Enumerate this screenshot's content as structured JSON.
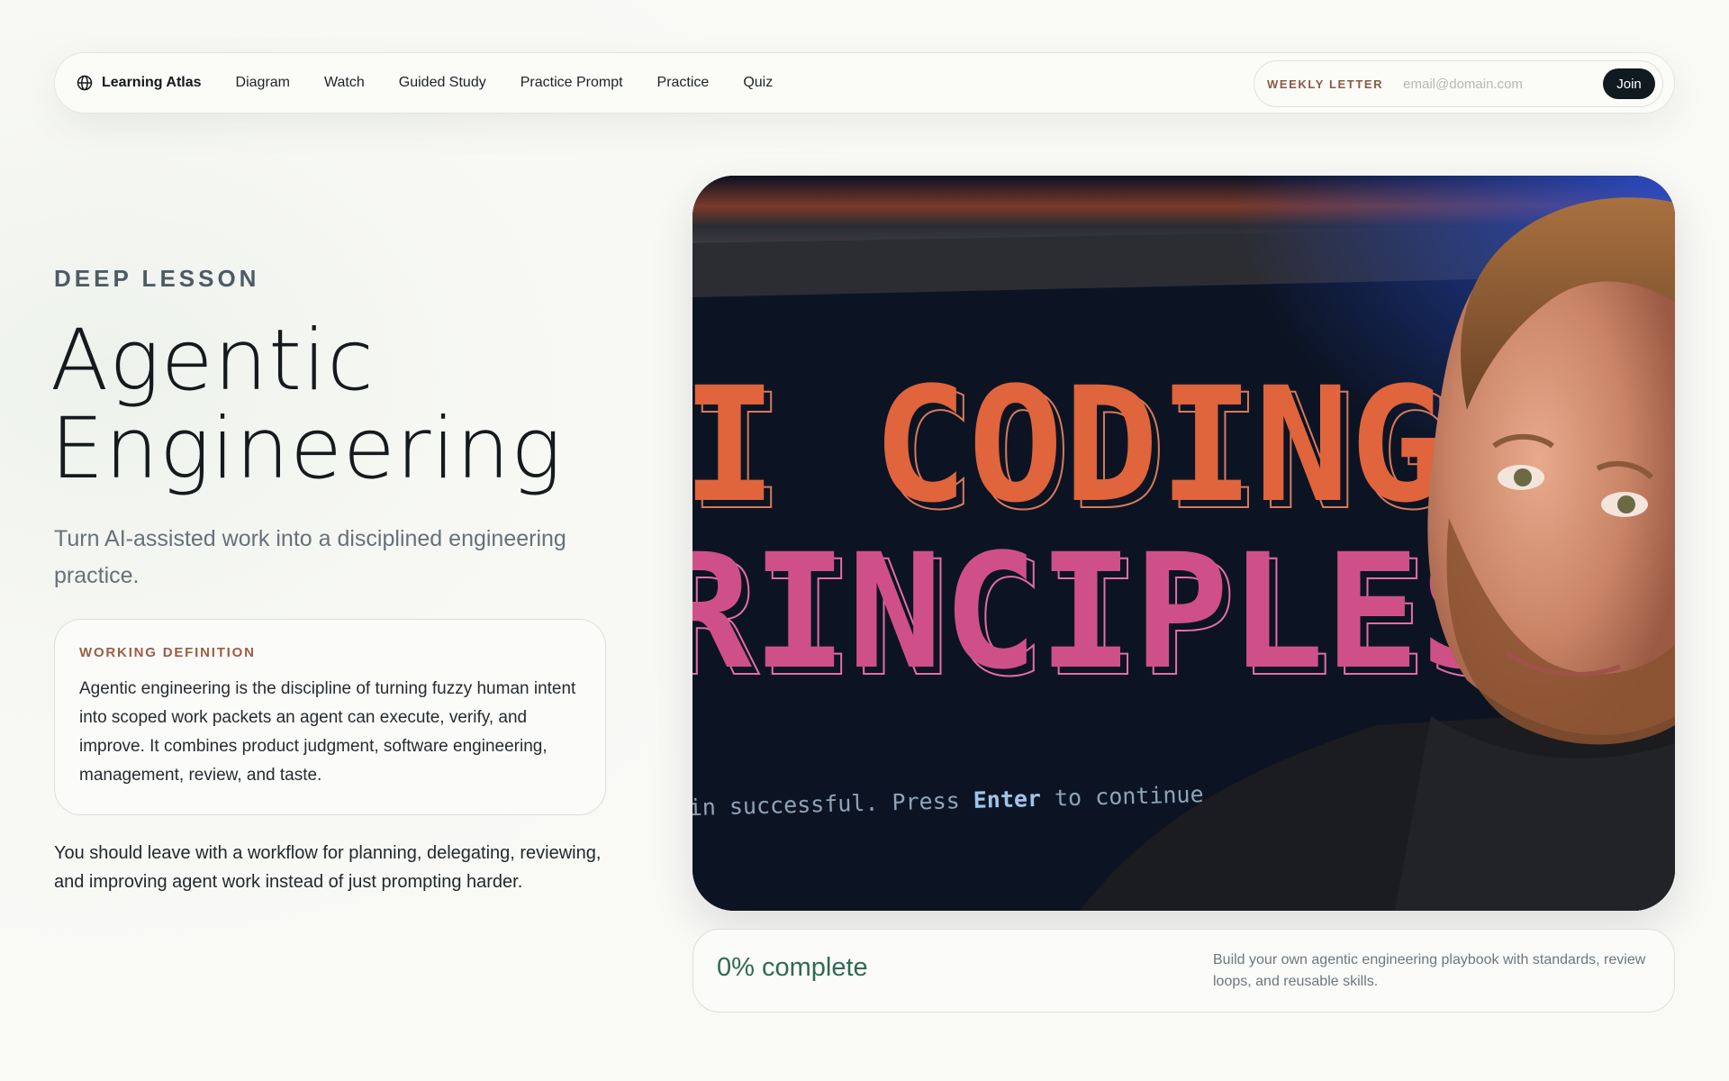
{
  "nav": {
    "brand": "Learning Atlas",
    "brand_icon": "globe-icon",
    "links": [
      "Diagram",
      "Watch",
      "Guided Study",
      "Practice Prompt",
      "Practice",
      "Quiz"
    ],
    "newsletter": {
      "label": "WEEKLY LETTER",
      "placeholder": "email@domain.com",
      "button": "Join"
    }
  },
  "hero": {
    "eyebrow": "DEEP LESSON",
    "title_line1": "Agentic",
    "title_line2": "Engineering",
    "subtitle": "Turn AI-assisted work into a disciplined engineering practice.",
    "definition": {
      "label": "WORKING DEFINITION",
      "text": "Agentic engineering is the discipline of turning fuzzy human intent into scoped work packets an agent can execute, verify, and improve. It combines product judgment, software engineering, management, review, and taste."
    },
    "outcome": "You should leave with a workflow for planning, delegating, reviewing, and improving agent work instead of just prompting harder."
  },
  "video": {
    "thumb_line1": "I CODING",
    "thumb_line2": "RINCIPLES",
    "terminal_prefix": "in successful. Press ",
    "terminal_key": "Enter",
    "terminal_suffix": " to continue"
  },
  "progress": {
    "complete_fraction": 0,
    "label": "0% complete",
    "description": "Build your own agentic engineering playbook with standards, review loops, and reusable skills."
  },
  "colors": {
    "accent_rust": "#9a5e45",
    "progress_green": "#2f6a52",
    "thumb_orange": "#e0643c",
    "thumb_pink": "#cf5088",
    "button_dark": "#111a1f"
  }
}
